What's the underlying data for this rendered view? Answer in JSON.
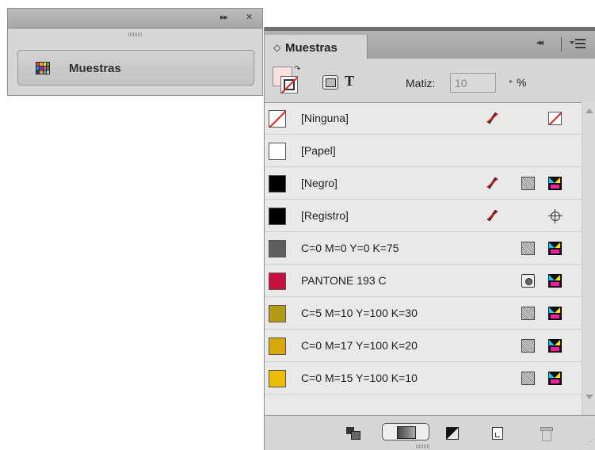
{
  "mini_panel": {
    "titlebar_controls": [
      "▸▸",
      "✕"
    ],
    "grip": "IIIIIIIII",
    "button_label": "Muestras",
    "icon": "swatches-grid-icon"
  },
  "panel": {
    "tab_arrows": "◇",
    "tab_label": "Muestras",
    "collapse_glyph": "◂◂",
    "menu_icon": "panel-menu-icon"
  },
  "controls": {
    "tint_label": "Matiz:",
    "tint_value": "10",
    "tint_unit": "%",
    "tint_arrow": "▸",
    "text_icon": "T"
  },
  "swatches": [
    {
      "name": "[Ninguna]",
      "color": "none"
    },
    {
      "name": "[Papel]",
      "color": "#ffffff"
    },
    {
      "name": "[Negro]",
      "color": "#000000"
    },
    {
      "name": "[Registro]",
      "color": "#000000"
    },
    {
      "name": "C=0 M=0 Y=0 K=75",
      "color": "#5e5e5e"
    },
    {
      "name": "PANTONE 193 C",
      "color": "#c8103e"
    },
    {
      "name": "C=5 M=10 Y=100 K=30",
      "color": "#b49a15"
    },
    {
      "name": "C=0 M=17 Y=100 K=20",
      "color": "#d6a80a"
    },
    {
      "name": "C=0 M=15 Y=100 K=10",
      "color": "#ebbc06"
    }
  ],
  "bottom_grip": "IIIIIIIII",
  "resize_grip": "⋰"
}
